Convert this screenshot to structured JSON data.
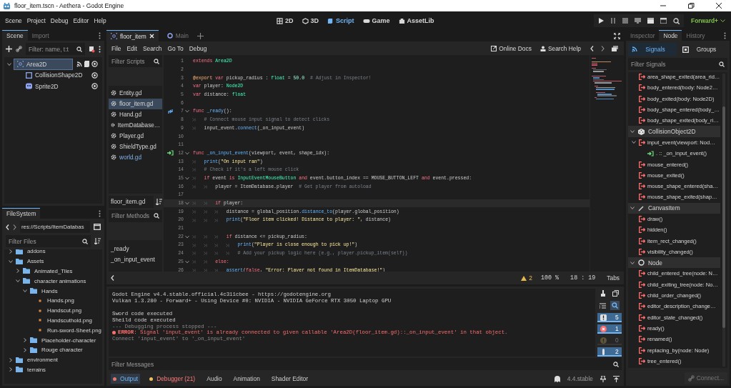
{
  "window": {
    "title": "floor_item.tscn - Aethera - Godot Engine"
  },
  "menu": [
    "Scene",
    "Project",
    "Debug",
    "Editor",
    "Help"
  ],
  "workspaces": [
    {
      "label": "2D",
      "kind": "plane",
      "selected": false
    },
    {
      "label": "3D",
      "kind": "space",
      "selected": false
    },
    {
      "label": "Script",
      "kind": "script",
      "selected": true
    },
    {
      "label": "Game",
      "kind": "game",
      "selected": false
    },
    {
      "label": "AssetLib",
      "kind": "assetlib",
      "selected": false
    }
  ],
  "renderer": "Forward+",
  "scene_dock": {
    "tabs": [
      {
        "label": "Scene",
        "selected": true
      },
      {
        "label": "Import",
        "selected": false
      }
    ],
    "filter": {
      "placeholder": "Filter: name, t:t"
    },
    "tree": [
      {
        "label": "Area2D",
        "kind": "area",
        "selected": true,
        "expanded": true,
        "children": [
          {
            "label": "CollisionShape2D",
            "kind": "shape",
            "selected": false
          },
          {
            "label": "Sprite2D",
            "kind": "sprite",
            "selected": false
          }
        ]
      }
    ]
  },
  "filesystem": {
    "tab": "FileSystem",
    "path": "res://Scripts/ItemDatabas",
    "filter": {
      "placeholder": "Filter Files"
    },
    "tree": [
      {
        "label": "addons",
        "kind": "folder",
        "expanded": false
      },
      {
        "label": "Assets",
        "kind": "folder",
        "expanded": true,
        "children": [
          {
            "label": "Animated_Tiles",
            "kind": "folder",
            "expanded": false
          },
          {
            "label": "character animations",
            "kind": "folder",
            "expanded": true,
            "children": [
              {
                "label": "Hands",
                "kind": "folder",
                "expanded": true,
                "children": [
                  {
                    "label": "Hands.png",
                    "kind": "image"
                  },
                  {
                    "label": "Handscut.png",
                    "kind": "image"
                  },
                  {
                    "label": "Handscuthold.png",
                    "kind": "image"
                  },
                  {
                    "label": "Run-sword-Sheet.png",
                    "kind": "image"
                  }
                ]
              },
              {
                "label": "Placeholder-character",
                "kind": "folder",
                "expanded": false
              },
              {
                "label": "Rouge character",
                "kind": "folder",
                "expanded": false
              }
            ]
          }
        ]
      },
      {
        "label": "environment",
        "kind": "folder",
        "expanded": false
      },
      {
        "label": "terrains",
        "kind": "folder",
        "expanded": false
      }
    ]
  },
  "script_tabs": [
    {
      "label": "floor_item",
      "kind": "scene",
      "selected": true
    },
    {
      "label": "Main",
      "kind": "node",
      "selected": false
    }
  ],
  "script_menu": [
    "File",
    "Edit",
    "Search",
    "Go To",
    "Debug"
  ],
  "help_links": [
    {
      "label": "Online Docs",
      "kind": "docs"
    },
    {
      "label": "Search Help",
      "kind": "help"
    }
  ],
  "scripts": {
    "filter": {
      "placeholder": "Filter Scripts"
    },
    "items": [
      {
        "label": "Entity.gd",
        "selected": false,
        "highlighted": false
      },
      {
        "label": "floor_item.gd",
        "selected": true,
        "highlighted": false
      },
      {
        "label": "Hand.gd",
        "selected": false,
        "highlighted": false
      },
      {
        "label": "ItemDatabase…",
        "selected": false,
        "highlighted": false
      },
      {
        "label": "Player.gd",
        "selected": false,
        "highlighted": false
      },
      {
        "label": "ShieldType.gd",
        "selected": false,
        "highlighted": false
      },
      {
        "label": "world.gd",
        "selected": false,
        "highlighted": true
      }
    ]
  },
  "current_script": "floor_item.gd",
  "methods": {
    "filter": {
      "placeholder": "Filter Methods"
    },
    "items": [
      "_ready",
      "_on_input_event"
    ]
  },
  "code": [
    {
      "num": "1",
      "tokens": [
        {
          "kind": "keyword",
          "text": "extends "
        },
        {
          "kind": "type",
          "text": "Area2D"
        }
      ]
    },
    {
      "num": "2"
    },
    {
      "num": "3",
      "tokens": [
        {
          "kind": "annotation",
          "text": "@export "
        },
        {
          "kind": "keyword",
          "text": "var "
        },
        {
          "kind": "plain",
          "text": "pickup_radius : "
        },
        {
          "kind": "type",
          "text": "float"
        },
        {
          "kind": "plain",
          "text": " = "
        },
        {
          "kind": "number",
          "text": "50.0"
        },
        {
          "kind": "comment",
          "text": "  # Adjust in Inspector!"
        }
      ]
    },
    {
      "num": "4",
      "tokens": [
        {
          "kind": "keyword",
          "text": "var "
        },
        {
          "kind": "plain",
          "text": "player: "
        },
        {
          "kind": "type",
          "text": "Node2D"
        }
      ]
    },
    {
      "num": "5",
      "tokens": [
        {
          "kind": "keyword",
          "text": "var "
        },
        {
          "kind": "plain",
          "text": "distance: "
        },
        {
          "kind": "type",
          "text": "float"
        }
      ]
    },
    {
      "num": "6"
    },
    {
      "num": "7",
      "fold": true,
      "kind": "override",
      "tokens": [
        {
          "kind": "keyword",
          "text": "func "
        },
        {
          "kind": "call",
          "text": "_ready"
        },
        {
          "kind": "plain",
          "text": "():"
        }
      ]
    },
    {
      "num": "8",
      "tokens": [
        {
          "kind": "comment",
          "text": "\t# Connect mouse input signal to detect clicks"
        }
      ]
    },
    {
      "num": "9",
      "tokens": [
        {
          "kind": "plain",
          "text": "\tinput_event."
        },
        {
          "kind": "call",
          "text": "connect"
        },
        {
          "kind": "plain",
          "text": "(_on_input_event)"
        }
      ]
    },
    {
      "num": "10"
    },
    {
      "num": "11"
    },
    {
      "num": "12",
      "fold": true,
      "kind": "connected",
      "tokens": [
        {
          "kind": "keyword",
          "text": "func "
        },
        {
          "kind": "call",
          "text": "_on_input_event"
        },
        {
          "kind": "plain",
          "text": "(viewport, event, shape_idx):"
        }
      ]
    },
    {
      "num": "13",
      "tokens": [
        {
          "kind": "call",
          "text": "\tprint"
        },
        {
          "kind": "plain",
          "text": "("
        },
        {
          "kind": "string",
          "text": "\"On input ran\""
        },
        {
          "kind": "plain",
          "text": ")"
        }
      ]
    },
    {
      "num": "14",
      "tokens": [
        {
          "kind": "comment",
          "text": "\t# Check if it's a left mouse click"
        }
      ]
    },
    {
      "num": "15",
      "fold": true,
      "tokens": [
        {
          "kind": "keyword",
          "text": "\tif "
        },
        {
          "kind": "plain",
          "text": "event "
        },
        {
          "kind": "keyword",
          "text": "is "
        },
        {
          "kind": "type",
          "text": "InputEventMouseButton"
        },
        {
          "kind": "keyword",
          "text": " and "
        },
        {
          "kind": "plain",
          "text": "event.button_index == MOUSE_BUTTON_LEFT "
        },
        {
          "kind": "keyword",
          "text": "and "
        },
        {
          "kind": "plain",
          "text": "event.pressed:"
        }
      ]
    },
    {
      "num": "16",
      "tokens": [
        {
          "kind": "plain",
          "text": "\t\tplayer = ItemDatabase.player  "
        },
        {
          "kind": "comment",
          "text": "# Get player from autoload"
        }
      ]
    },
    {
      "num": "17"
    },
    {
      "num": "18",
      "fold": true,
      "current": true,
      "tokens": [
        {
          "kind": "keyword",
          "text": "\t\tif "
        },
        {
          "kind": "plain",
          "text": "player:"
        }
      ]
    },
    {
      "num": "19",
      "tokens": [
        {
          "kind": "plain",
          "text": "\t\t\tdistance = global_position."
        },
        {
          "kind": "call",
          "text": "distance_to"
        },
        {
          "kind": "plain",
          "text": "(player.global_position)"
        }
      ]
    },
    {
      "num": "20",
      "tokens": [
        {
          "kind": "call",
          "text": "\t\t\tprint"
        },
        {
          "kind": "plain",
          "text": "("
        },
        {
          "kind": "string",
          "text": "\"Floor item clicked! Distance to player: \""
        },
        {
          "kind": "plain",
          "text": ", distance)"
        }
      ]
    },
    {
      "num": "21"
    },
    {
      "num": "22",
      "fold": true,
      "tokens": [
        {
          "kind": "keyword",
          "text": "\t\t\tif "
        },
        {
          "kind": "plain",
          "text": "distance <= pickup_radius:"
        }
      ]
    },
    {
      "num": "23",
      "tokens": [
        {
          "kind": "call",
          "text": "\t\t\t\tprint"
        },
        {
          "kind": "plain",
          "text": "("
        },
        {
          "kind": "string",
          "text": "\"Player is close enough to pick up!\""
        },
        {
          "kind": "plain",
          "text": ")"
        }
      ]
    },
    {
      "num": "24",
      "tokens": [
        {
          "kind": "comment",
          "text": "\t\t\t\t# Add your pickup logic here (e.g., player.pickup_item(self))"
        }
      ]
    },
    {
      "num": "25",
      "fold": true,
      "tokens": [
        {
          "kind": "keyword",
          "text": "\t\telse:"
        }
      ]
    },
    {
      "num": "26",
      "tokens": [
        {
          "kind": "call",
          "text": "\t\t\tassert"
        },
        {
          "kind": "plain",
          "text": "("
        },
        {
          "kind": "keyword",
          "text": "false"
        },
        {
          "kind": "plain",
          "text": ", "
        },
        {
          "kind": "string",
          "text": "\"Error: Player not found in ItemDatabase!\""
        },
        {
          "kind": "plain",
          "text": ")"
        }
      ]
    }
  ],
  "status": {
    "warnings": "2",
    "zoom": "100 %",
    "position": "18 :  19",
    "indent": "Tabs"
  },
  "output": {
    "groups": [
      [
        {
          "kind": "normal",
          "text": "Godot Engine v4.4.stable.official.4c311cbee - https://godotengine.org"
        },
        {
          "kind": "normal",
          "text": "Vulkan 1.3.280 - Forward+ - Using Device #0: NVIDIA - NVIDIA GeForce RTX 3050 Laptop GPU"
        }
      ],
      [
        {
          "kind": "normal",
          "text": "Sword code executed"
        },
        {
          "kind": "normal",
          "text": "Sheild code executed"
        },
        {
          "kind": "dim",
          "text": "--- Debugging process stopped ---"
        },
        {
          "kind": "error",
          "text": "**ERROR:** Signal 'input_event' is already connected to given callable 'Area2D(floor_item.gd)::_on_input_event' in that object."
        },
        {
          "kind": "dim",
          "text": "Connect 'input_event' to '_on_input_event'"
        }
      ]
    ],
    "filter": {
      "placeholder": "Filter Messages"
    },
    "counters": [
      {
        "kind": "message",
        "count": "5",
        "pressed": true
      },
      {
        "kind": "error",
        "count": "1",
        "pressed": true
      },
      {
        "kind": "warning",
        "count": "0",
        "pressed": false
      },
      {
        "kind": "editor",
        "count": "2",
        "pressed": true
      }
    ]
  },
  "bottom_tabs": [
    {
      "label": "Output",
      "selected": true,
      "color": "#e8786a"
    },
    {
      "label": "Debugger (21)",
      "selected": false,
      "color": "#f0c060",
      "kind": "error"
    },
    {
      "label": "Audio",
      "selected": false
    },
    {
      "label": "Animation",
      "selected": false
    },
    {
      "label": "Shader Editor",
      "selected": false
    }
  ],
  "version": "4.4.stable",
  "node_dock": {
    "tabs": [
      {
        "label": "Inspector",
        "selected": false
      },
      {
        "label": "Node",
        "selected": true
      },
      {
        "label": "History",
        "selected": false
      }
    ],
    "modes": [
      {
        "label": "Signals",
        "kind": "signals",
        "selected": true
      },
      {
        "label": "Groups",
        "kind": "groups",
        "selected": false
      }
    ],
    "filter": {
      "placeholder": "Filter Signals"
    },
    "groups": [
      {
        "items": [
          {
            "label": "area_shape_exited(area_rid…"
          },
          {
            "label": "body_entered(body: Node2…"
          },
          {
            "label": "body_exited(body: Node2D)"
          },
          {
            "label": "body_shape_entered(body_…"
          },
          {
            "label": "body_shape_exited(body_ri…"
          }
        ]
      },
      {
        "title": "CollisionObject2D",
        "kind": "physics",
        "expanded": true,
        "items": [
          {
            "label": "input_event(viewport: Nod…",
            "expanded": true,
            "children": [
              {
                "label": ". :: _on_input_event()"
              }
            ]
          },
          {
            "label": "mouse_entered()"
          },
          {
            "label": "mouse_exited()"
          },
          {
            "label": "mouse_shape_entered(sha…"
          },
          {
            "label": "mouse_shape_exited(shap…"
          }
        ]
      },
      {
        "title": "CanvasItem",
        "kind": "canvas",
        "expanded": true,
        "items": [
          {
            "label": "draw()"
          },
          {
            "label": "hidden()"
          },
          {
            "label": "item_rect_changed()"
          },
          {
            "label": "visibility_changed()"
          }
        ]
      },
      {
        "title": "Node",
        "kind": "node",
        "expanded": true,
        "items": [
          {
            "label": "child_entered_tree(node: N…"
          },
          {
            "label": "child_exiting_tree(node: No…"
          },
          {
            "label": "child_order_changed()"
          },
          {
            "label": "editor_description_change…"
          },
          {
            "label": "editor_state_changed()"
          },
          {
            "label": "ready()"
          },
          {
            "label": "renamed()"
          },
          {
            "label": "replacing_by(node: Node)"
          },
          {
            "label": "tree_entered()"
          }
        ]
      }
    ],
    "connect_button": {
      "label": "Connect...",
      "disabled": true
    }
  }
}
